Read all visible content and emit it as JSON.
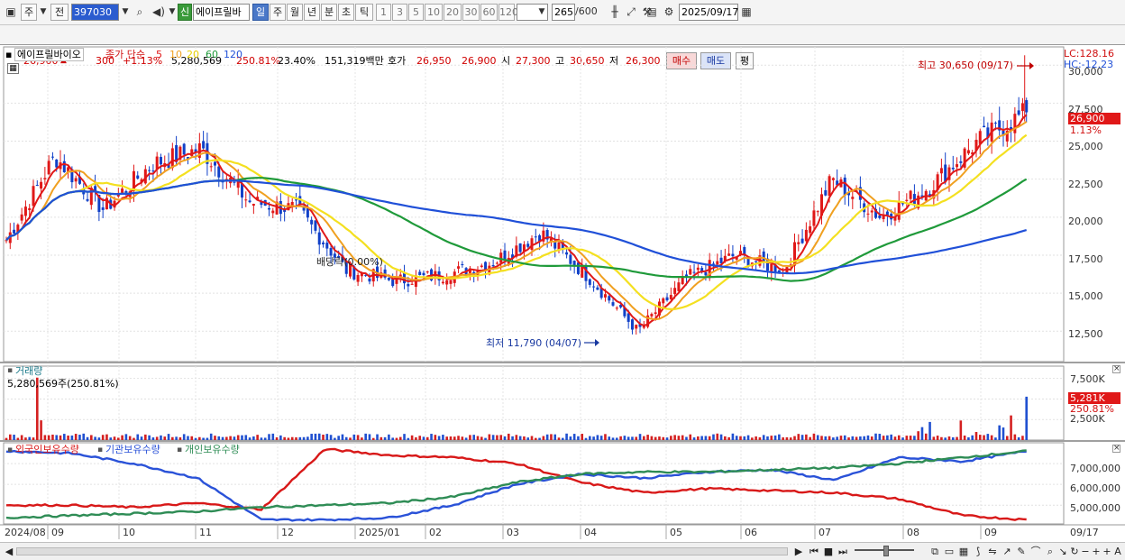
{
  "toolbar": {
    "market_label": "주",
    "prev_label": "전",
    "code_value": "397030",
    "new_badge": "신",
    "stock_name": "에이프릴바",
    "period_day": "일",
    "period_week": "주",
    "period_month": "월",
    "period_year": "년",
    "period_minute": "분",
    "period_second": "초",
    "period_tick": "틱",
    "intervals": [
      "1",
      "3",
      "5",
      "10",
      "20",
      "30",
      "60",
      "120"
    ],
    "count_value": "265",
    "count_total": "/600",
    "date_value": "2025/09/17"
  },
  "quote": {
    "price": "26,900",
    "change": "300",
    "change_pct": "+1.13%",
    "volume": "5,280,569",
    "volume_ratio": "250.81%",
    "turnover": "23.40%",
    "amount": "151,319백만",
    "ask_label": "호가",
    "ask_price": "26,950",
    "bid_price": "26,900",
    "open_label": "시",
    "open": "27,300",
    "high_label": "고",
    "high": "30,650",
    "low_label": "저",
    "low": "26,300",
    "buy_label": "매수",
    "sell_label": "매도",
    "eval_label": "평"
  },
  "price_panel": {
    "stock_label": "에이프릴바이오",
    "ma_title": "종가 단순",
    "ma_periods": [
      "5",
      "10",
      "20",
      "60",
      "120"
    ],
    "ma_colors": [
      "#e01818",
      "#f0a020",
      "#f4e020",
      "#1f9a3a",
      "#2050d8"
    ],
    "lc_label": "LC:128.16",
    "hc_label": "HC:-12.23",
    "high_annotation": "최고 30,650 (09/17)",
    "low_annotation": "최저 11,790 (04/07)",
    "ex_rights": "배당락(0.00%)",
    "current_tag": "26,900",
    "current_pct": "1.13%",
    "y_ticks": [
      "30,000",
      "27,500",
      "25,000",
      "22,500",
      "20,000",
      "17,500",
      "15,000",
      "12,500"
    ]
  },
  "volume_panel": {
    "title": "거래량",
    "summary": "5,280,569주(250.81%)",
    "current_tag": "5,281K",
    "current_pct": "250.81%",
    "y_ticks": [
      "7,500K",
      "5,000K",
      "2,500K"
    ]
  },
  "holdings_panel": {
    "foreign_label": "외국인보유수량",
    "institution_label": "기관보유수량",
    "individual_label": "개인보유수량",
    "series_colors": [
      "#d81818",
      "#2a52d8",
      "#2e8c55"
    ],
    "y_ticks": [
      "7,000,000",
      "6,000,000",
      "5,000,000"
    ]
  },
  "x_axis": {
    "labels": [
      "2024/08",
      "09",
      "10",
      "11",
      "12",
      "2025/01",
      "02",
      "03",
      "04",
      "05",
      "06",
      "07",
      "08",
      "09"
    ],
    "end_label": "09/17"
  },
  "chart_data": [
    {
      "type": "candlestick",
      "period": "daily",
      "x_range": [
        "2024/08",
        "2025/09/17"
      ],
      "ylim": [
        10500,
        31200
      ],
      "points": [
        [
          "2024/08",
          18500
        ],
        [
          "2024/09 early",
          24000
        ],
        [
          "2024/09 mid",
          20500
        ],
        [
          "2024/10 early",
          23500
        ],
        [
          "2024/10 late",
          24500
        ],
        [
          "2024/11 early",
          21000
        ],
        [
          "2024/11 mid",
          20500
        ],
        [
          "2024/11 late",
          16500
        ],
        [
          "2024/12 mid",
          15800
        ],
        [
          "2025/01",
          16200
        ],
        [
          "2025/02",
          17000
        ],
        [
          "2025/03 early",
          19000
        ],
        [
          "2025/03 late",
          16000
        ],
        [
          "2025/04/07",
          12500
        ],
        [
          "2025/05",
          16000
        ],
        [
          "2025/06",
          17500
        ],
        [
          "2025/07 early",
          16500
        ],
        [
          "2025/07 late",
          22500
        ],
        [
          "2025/08 early",
          20000
        ],
        [
          "2025/08 late",
          22000
        ],
        [
          "2025/09 early",
          25000
        ],
        [
          "2025/09/17",
          26900
        ]
      ],
      "annotations": {
        "high": 30650,
        "low": 11790
      }
    },
    {
      "type": "bar",
      "series": "volume",
      "ylim": [
        0,
        9000000
      ],
      "last_value": 5280569
    },
    {
      "type": "line",
      "series": [
        {
          "name": "외국인보유수량",
          "start": 5000000,
          "end": 4300000
        },
        {
          "name": "기관보유수량",
          "start": 7000000,
          "end": 7600000
        },
        {
          "name": "개인보유수량",
          "start": 4300000,
          "end": 7600000
        }
      ]
    }
  ]
}
